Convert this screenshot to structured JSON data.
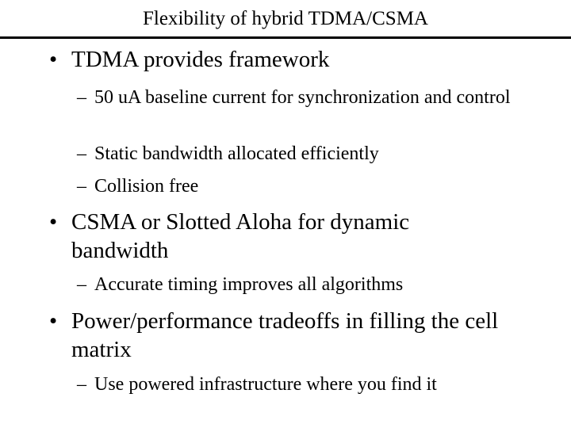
{
  "slide": {
    "title": "Flexibility of hybrid TDMA/CSMA",
    "bullet_glyph": "•",
    "dash_glyph": "–",
    "items": [
      {
        "level": 1,
        "text": "TDMA provides framework"
      },
      {
        "level": 2,
        "text": "50 uA baseline current for synchronization and control"
      },
      {
        "level": 2,
        "text": "Static bandwidth allocated efficiently"
      },
      {
        "level": 2,
        "text": "Collision free"
      },
      {
        "level": 1,
        "text": "CSMA or Slotted Aloha for dynamic bandwidth"
      },
      {
        "level": 2,
        "text": "Accurate timing improves all algorithms"
      },
      {
        "level": 1,
        "text": "Power/performance tradeoffs in filling the cell matrix"
      },
      {
        "level": 2,
        "text": "Use powered infrastructure where you find it"
      }
    ]
  }
}
